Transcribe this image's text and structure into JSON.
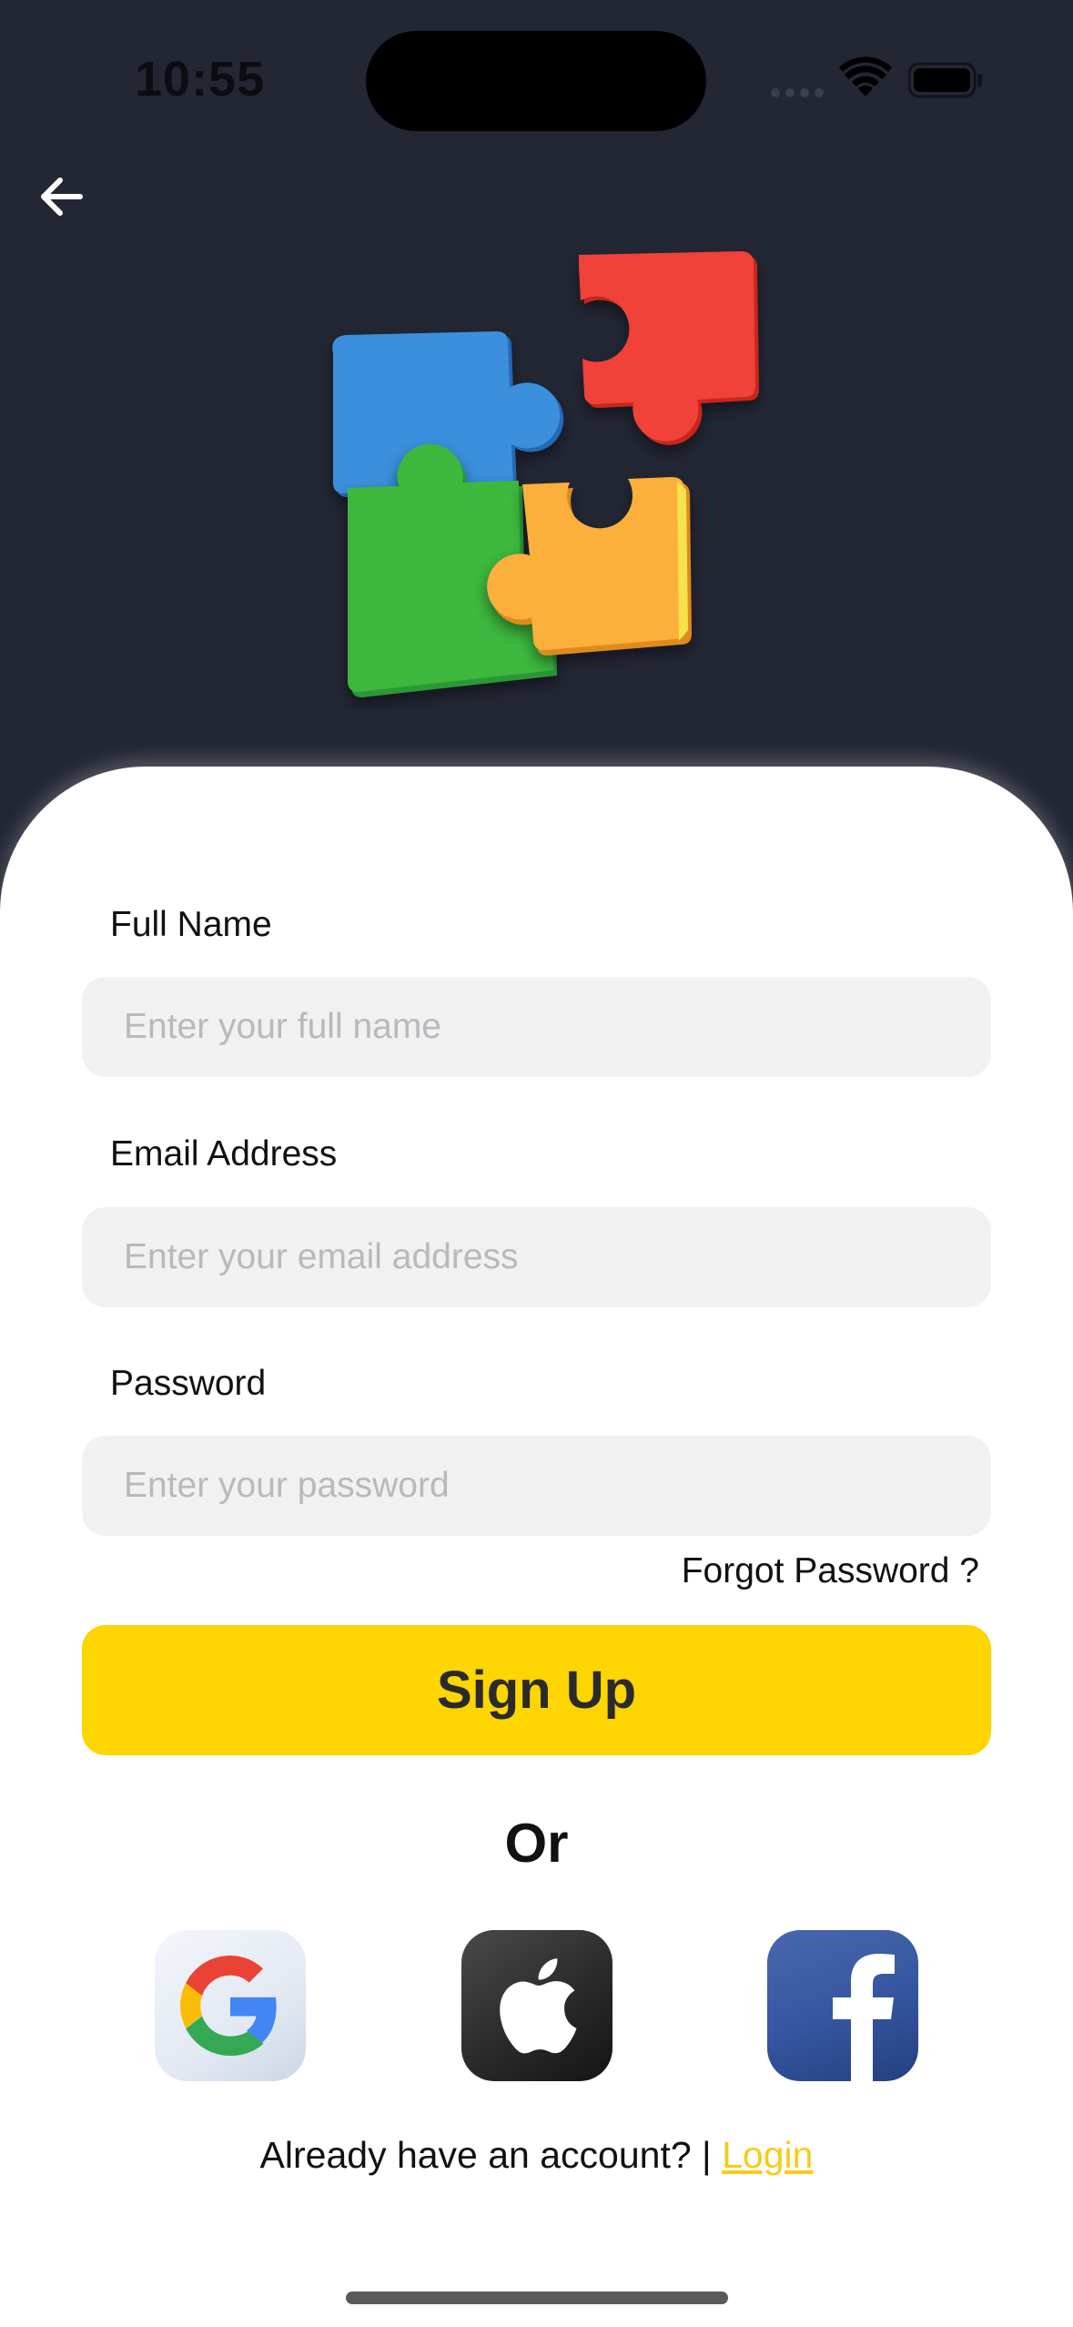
{
  "status_bar": {
    "time": "10:55"
  },
  "form": {
    "full_name": {
      "label": "Full Name",
      "placeholder": "Enter your full name"
    },
    "email": {
      "label": "Email Address",
      "placeholder": "Enter your email address"
    },
    "password": {
      "label": "Password",
      "placeholder": "Enter your password"
    },
    "forgot_password": "Forgot Password ?",
    "submit_label": "Sign Up"
  },
  "divider_text": "Or",
  "social": [
    {
      "name": "google-icon"
    },
    {
      "name": "apple-icon"
    },
    {
      "name": "facebook-icon"
    }
  ],
  "footer": {
    "prompt": "Already have an account? |",
    "login_label": "Login"
  },
  "colors": {
    "background": "#232734",
    "accent": "#fdd500",
    "link": "#f5cc1a",
    "input_bg": "#f1f1f2"
  }
}
